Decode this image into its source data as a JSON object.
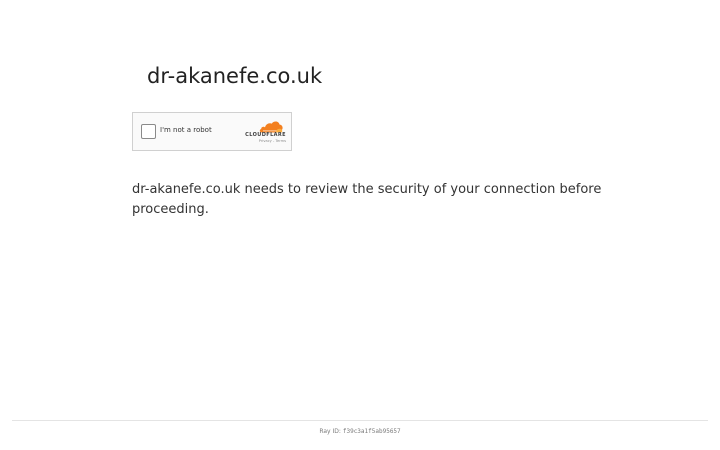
{
  "header": {
    "domain_title": "dr-akanefe.co.uk"
  },
  "captcha": {
    "checkbox_label": "I'm not a robot",
    "checked": false,
    "provider": {
      "wordmark": "CLOUDFLARE",
      "logo_icon": "cloudflare-cloud-icon",
      "privacy_link": "Privacy",
      "separator": "-",
      "terms_link": "Terms",
      "brand_colors": [
        "#f38020",
        "#faae40"
      ]
    }
  },
  "main": {
    "message": "dr-akanefe.co.uk needs to review the security of your connection before proceeding."
  },
  "footer": {
    "ray_label": "Ray ID:",
    "ray_id": "f39c3a1f5ab95657"
  }
}
